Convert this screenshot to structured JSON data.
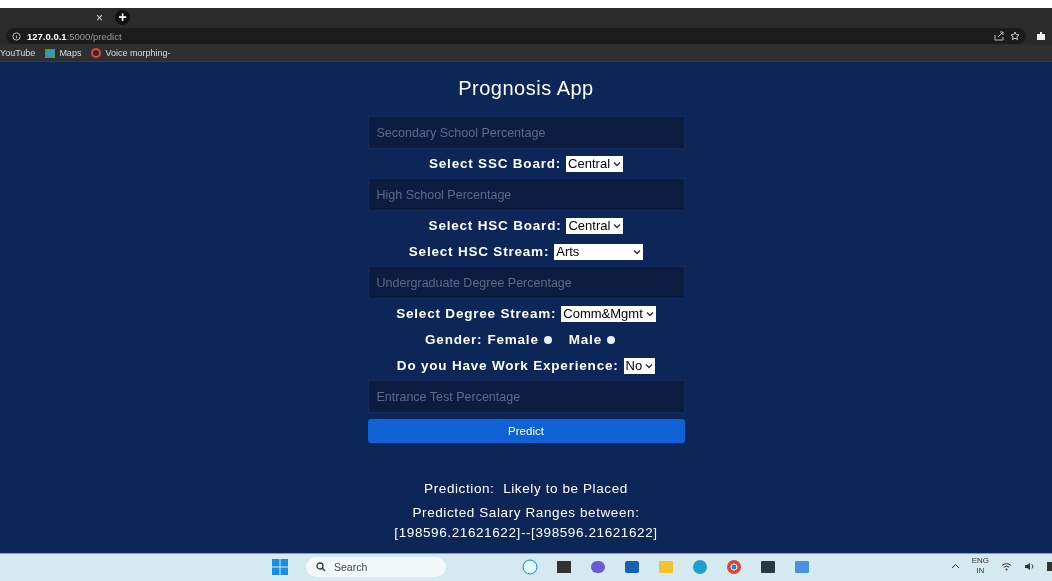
{
  "browser": {
    "tab_close": "×",
    "new_tab": "+",
    "url_host": "127.0.0.1",
    "url_path": ":5000/predict",
    "bookmarks": [
      "YouTube",
      "Maps",
      "Voice morphing-"
    ]
  },
  "page": {
    "title": "Prognosis App",
    "form": [
      {
        "kind": "input",
        "placeholder": "Secondary School Percentage"
      },
      {
        "kind": "select",
        "label": "Select SSC Board:",
        "value": "Central"
      },
      {
        "kind": "input",
        "placeholder": "High School Percentage"
      },
      {
        "kind": "select",
        "label": "Select HSC Board:",
        "value": "Central"
      },
      {
        "kind": "select",
        "label": "Select HSC Stream:",
        "value": "Arts"
      },
      {
        "kind": "input",
        "placeholder": "Undergraduate Degree Percentage"
      },
      {
        "kind": "select",
        "label": "Select Degree Stream:",
        "value": "Comm&Mgmt"
      },
      {
        "kind": "radio",
        "label": "Gender:",
        "options": [
          {
            "label": "Female",
            "selected": false
          },
          {
            "label": "Male",
            "selected": false
          }
        ]
      },
      {
        "kind": "select",
        "label": "Do you Have Work Experience:",
        "value": "No"
      },
      {
        "kind": "input",
        "placeholder": "Entrance Test Percentage"
      }
    ],
    "button": "Predict",
    "result": {
      "prediction": "Prediction:  Likely to be Placed",
      "salary_label": "Predicted Salary Ranges between:",
      "salary_value": "[198596.21621622]--[398596.21621622]"
    }
  },
  "taskbar": {
    "search_placeholder": "Search",
    "language": "ENG",
    "region": "IN"
  }
}
